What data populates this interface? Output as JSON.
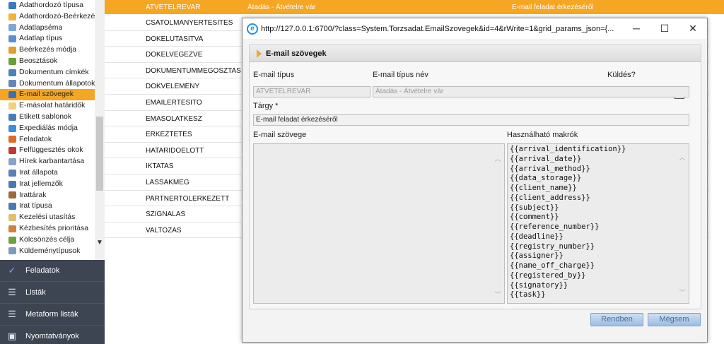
{
  "sidebar": {
    "items": [
      {
        "label": "Adathordozó típusa",
        "color": "#3a78c2"
      },
      {
        "label": "Adathordozó-Beérkezés",
        "color": "#f0b43c"
      },
      {
        "label": "Adatlapséma",
        "color": "#7aa6d8"
      },
      {
        "label": "Adatlap típus",
        "color": "#5a8fd0"
      },
      {
        "label": "Beérkezés módja",
        "color": "#e0a030"
      },
      {
        "label": "Beosztások",
        "color": "#6a9e3a"
      },
      {
        "label": "Dokumentum címkék",
        "color": "#4a7fb8"
      },
      {
        "label": "Dokumentum állapotok",
        "color": "#5f88b8"
      },
      {
        "label": "E-mail szövegek",
        "color": "#3d6fb5"
      },
      {
        "label": "E-másolat határidők",
        "color": "#f2d27a"
      },
      {
        "label": "Etikett sablonok",
        "color": "#4c7cb8"
      },
      {
        "label": "Expediálás módja",
        "color": "#3c8fd8"
      },
      {
        "label": "Feladatok",
        "color": "#e06a2a"
      },
      {
        "label": "Felfüggesztés okok",
        "color": "#c0392b"
      },
      {
        "label": "Hírek karbantartása",
        "color": "#8aa4c8"
      },
      {
        "label": "Irat állapota",
        "color": "#5a80b4"
      },
      {
        "label": "Irat jellemzők",
        "color": "#4a78b0"
      },
      {
        "label": "Irattárak",
        "color": "#9a6a3a"
      },
      {
        "label": "Irat típusa",
        "color": "#4a78b0"
      },
      {
        "label": "Kezelési utasítás",
        "color": "#e0c070"
      },
      {
        "label": "Kézbesítés prioritása",
        "color": "#d08040"
      },
      {
        "label": "Kölcsönzés célja",
        "color": "#6aa040"
      },
      {
        "label": "Küldeménytípusok",
        "color": "#7a9ac0"
      }
    ],
    "selected_index": 8
  },
  "nav": {
    "items": [
      {
        "label": "Feladatok",
        "icon": "checkmark-icon"
      },
      {
        "label": "Listák",
        "icon": "list-icon"
      },
      {
        "label": "Metaform listák",
        "icon": "list-icon"
      },
      {
        "label": "Nyomtatványok",
        "icon": "printer-icon"
      }
    ]
  },
  "grid": {
    "header": {
      "code": "ATVETELREVAR",
      "name": "Átadás - Átvételre vár",
      "subject": "E-mail feladat érkezéséről"
    },
    "rows": [
      "CSATOLMANYERTESITES",
      "DOKELUTASITVA",
      "DOKELVEGEZVE",
      "DOKUMENTUMMEGOSZTAS",
      "DOKVELEMENY",
      "EMAILERTESITO",
      "EMASOLATKESZ",
      "ERKEZTETES",
      "HATARIDOELOTT",
      "IKTATAS",
      "LASSAKMEG",
      "PARTNERTOLERKEZETT",
      "SZIGNALAS",
      "VALTOZAS"
    ]
  },
  "dialog": {
    "url": "http://127.0.0.1:6700/?class=System.Torzsadat.EmailSzovegek&id=4&rWrite=1&grid_params_json={...",
    "panel_title": "E-mail szövegek",
    "labels": {
      "type": "E-mail típus",
      "type_name": "E-mail típus név",
      "send": "Küldés?",
      "subject": "Tárgy *",
      "body": "E-mail szövege",
      "macros": "Használható makrók"
    },
    "values": {
      "type": "ATVETELREVAR",
      "type_name": "Átadás - Átvételre vár",
      "subject": "E-mail feladat érkezéséről",
      "send_checked": false
    },
    "macros": [
      "{{arrival_identification}}",
      "{{arrival_date}}",
      "{{arrival_method}}",
      "{{data_storage}}",
      "{{client_name}}",
      "{{client_address}}",
      "{{subject}}",
      "{{comment}}",
      "{{reference_number}}",
      "{{deadline}}",
      "{{registry_number}}",
      "{{assigner}}",
      "{{name_off_charge}}",
      "{{registered_by}}",
      "{{signatory}}",
      "{{task}}"
    ],
    "buttons": {
      "ok": "Rendben",
      "cancel": "Mégsem"
    }
  },
  "colors": {
    "accent": "#f5a623",
    "nav_bg": "#3d4452",
    "button_text": "#4a6d98"
  }
}
